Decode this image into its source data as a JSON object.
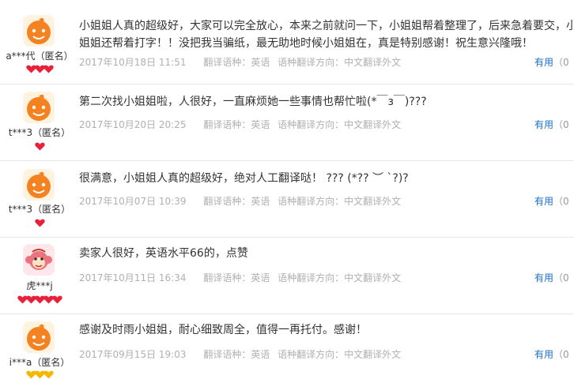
{
  "reviews": [
    {
      "user": "a***代（匿名）",
      "hearts": 3,
      "heart_color": "#e8203a",
      "avatar": "orange-face",
      "content_lines": [
        "小姐姐人真的超级好，大家可以完全放心，本来之前就问一下，小姐姐帮着整理了，后来急着要交，小",
        "姐姐还帮着打字！！没把我当骗纸，最无助地时候小姐姐在，真是特别感谢！祝生意兴隆哦！"
      ],
      "date": "2017年10月18日 11:51",
      "lang_label": "翻译语种：英语",
      "direction_label": "语种翻译方向：中文翻译外文",
      "helpful_label": "有用",
      "helpful_count": "（0"
    },
    {
      "user": "t***3（匿名）",
      "hearts": 1,
      "heart_color": "#e8203a",
      "avatar": "orange-face",
      "content_lines": [
        "第二次找小姐姐啦，人很好，一直麻烦她一些事情也帮忙啦(*￣з￣)???"
      ],
      "date": "2017年10月20日 20:25",
      "lang_label": "翻译语种：英语",
      "direction_label": "语种翻译方向：中文翻译外文",
      "helpful_label": "有用",
      "helpful_count": "（0"
    },
    {
      "user": "t***3（匿名）",
      "hearts": 1,
      "heart_color": "#e8203a",
      "avatar": "orange-face",
      "content_lines": [
        "很满意，小姐姐人真的超级好，绝对人工翻译哒！ ??? (*?? ︶ `?)?"
      ],
      "date": "2017年10月07日 10:39",
      "lang_label": "翻译语种：英语",
      "direction_label": "语种翻译方向：中文翻译外文",
      "helpful_label": "有用",
      "helpful_count": "（0"
    },
    {
      "user": "虎***j",
      "hearts": 5,
      "heart_color": "#e8203a",
      "avatar": "cartoon-monkey",
      "content_lines": [
        "卖家人很好，英语水平66的，点赞"
      ],
      "date": "2017年10月11日 16:34",
      "lang_label": "翻译语种：英语",
      "direction_label": "语种翻译方向：中文翻译外文",
      "helpful_label": "有用",
      "helpful_count": "（0"
    },
    {
      "user": "i***a（匿名）",
      "hearts": 3,
      "heart_color": "#f5b800",
      "avatar": "orange-face",
      "content_lines": [
        "感谢及时雨小姐姐，耐心细致周全，值得一再托付。感谢！"
      ],
      "date": "2017年09月15日 19:03",
      "lang_label": "翻译语种：英语",
      "direction_label": "语种翻译方向：中文翻译外文",
      "helpful_label": "有用",
      "helpful_count": "（0"
    }
  ]
}
